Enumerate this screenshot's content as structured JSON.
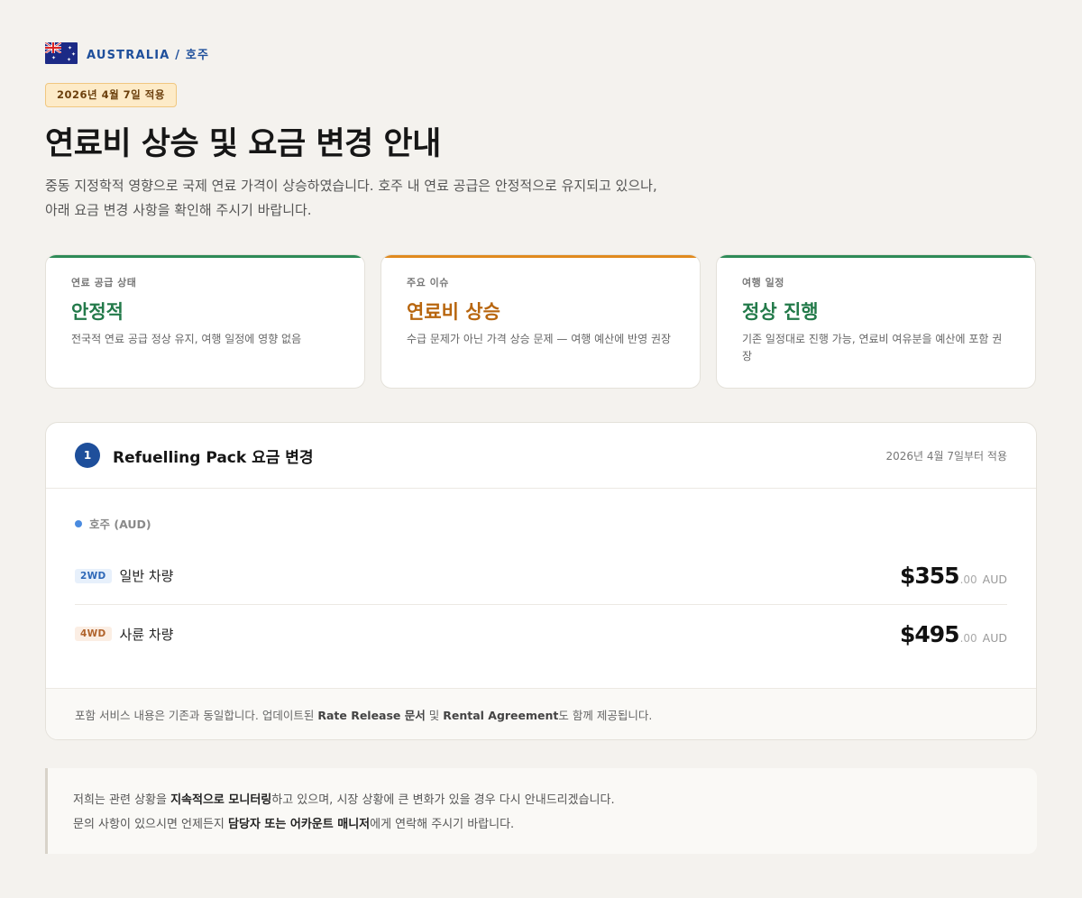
{
  "header": {
    "country": "AUSTRALIA / 호주",
    "date_badge": "2026년 4월 7일 적용",
    "title": "연료비 상승 및 요금 변경 안내",
    "intro": "중동 지정학적 영향으로 국제 연료 가격이 상승하였습니다. 호주 내 연료 공급은 안정적으로 유지되고 있으나, 아래 요금 변경 사항을 확인해 주시기 바랍니다."
  },
  "cards": [
    {
      "label": "연료 공급 상태",
      "value": "안정적",
      "desc": "전국적 연료 공급 정상 유지, 여행 일정에 영향 없음",
      "color": "#2e8b57",
      "value_color": "#237a4a"
    },
    {
      "label": "주요 이슈",
      "value": "연료비 상승",
      "desc": "수급 문제가 아닌 가격 상승 문제 — 여행 예산에 반영 권장",
      "color": "#e08a1e",
      "value_color": "#b8660f"
    },
    {
      "label": "여행 일정",
      "value": "정상 진행",
      "desc": "기존 일정대로 진행 가능, 연료비 여유분을 예산에 포함 권장",
      "color": "#2e8b57",
      "value_color": "#237a4a"
    }
  ],
  "panel": {
    "step": "1",
    "title": "Refuelling Pack 요금 변경",
    "date": "2026년 4월 7일부터 적용",
    "region": "호주 (AUD)",
    "rows": [
      {
        "tag": "2WD",
        "vehicle": "일반 차량",
        "amount": "$355",
        "cents": ".00",
        "currency": "AUD"
      },
      {
        "tag": "4WD",
        "vehicle": "사륜 차량",
        "amount": "$495",
        "cents": ".00",
        "currency": "AUD"
      }
    ],
    "footer": {
      "text1": "포함 서비스 내용은 기존과 동일합니다. 업데이트된 ",
      "bold1": "Rate Release 문서",
      "text2": " 및 ",
      "bold2": "Rental Agreement",
      "text3": "도 함께 제공됩니다."
    }
  },
  "notice": {
    "line1_a": "저희는 관련 상황을 ",
    "line1_b": "지속적으로 모니터링",
    "line1_c": "하고 있으며, 시장 상황에 큰 변화가 있을 경우 다시 안내드리겠습니다.",
    "line2_a": "문의 사항이 있으시면 언제든지 ",
    "line2_b": "담당자 또는 어카운트 매니저",
    "line2_c": "에게 연락해 주시기 바랍니다."
  }
}
